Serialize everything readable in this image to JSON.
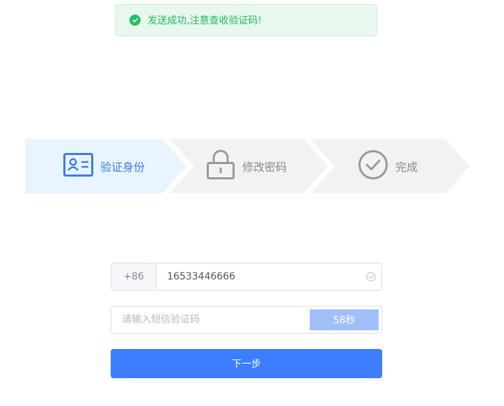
{
  "toast": {
    "message": "发送成功,注意查收验证码!",
    "icon": "check-circle-icon",
    "color": "#1dbb5f"
  },
  "steps": [
    {
      "label": "验证身份",
      "icon": "id-card-icon",
      "active": true
    },
    {
      "label": "修改密码",
      "icon": "lock-icon",
      "active": false
    },
    {
      "label": "完成",
      "icon": "check-circle-icon",
      "active": false
    }
  ],
  "form": {
    "phone_prefix": "+86",
    "phone_value": "16533446666",
    "code_placeholder": "请输入短信验证码",
    "countdown": "58秒",
    "next_label": "下一步"
  },
  "colors": {
    "primary": "#3d7eff",
    "active_step_bg": "#e8f4ff",
    "inactive_step_bg": "#f2f2f2",
    "countdown_bg": "#a0bffa"
  }
}
